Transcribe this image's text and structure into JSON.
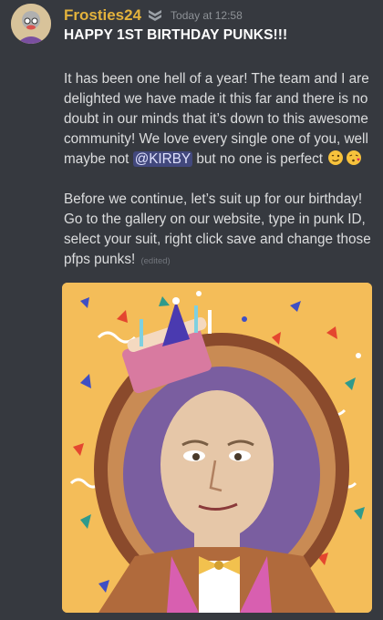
{
  "message": {
    "username": "Frosties24",
    "timestamp": "Today at 12:58",
    "title": "HAPPY 1ST BIRTHDAY PUNKS!!!",
    "para1": "It has been one hell of a year! The team and I are delighted we have made it this far and there is no doubt in our minds that it’s down to this awesome community! We love every single one of you, well maybe not ",
    "mention": "@KIRBY",
    "para1_end": " but no one is perfect ",
    "emojis": [
      "winking-face",
      "face-blowing-kiss"
    ],
    "para2": "Before we continue, let’s suit up for our birthday! Go to the gallery on our website, type in punk ID, select your suit, right click save and change those pfps punks!",
    "edited": "(edited)"
  },
  "colors": {
    "background": "#36393f",
    "username": "#e3b23c",
    "text": "#dcddde",
    "mention_bg": "#5865f2",
    "image_bg": "#f4bd59"
  },
  "icons": {
    "badge": "chevron-rank-badge-icon",
    "avatar": "user-avatar"
  }
}
